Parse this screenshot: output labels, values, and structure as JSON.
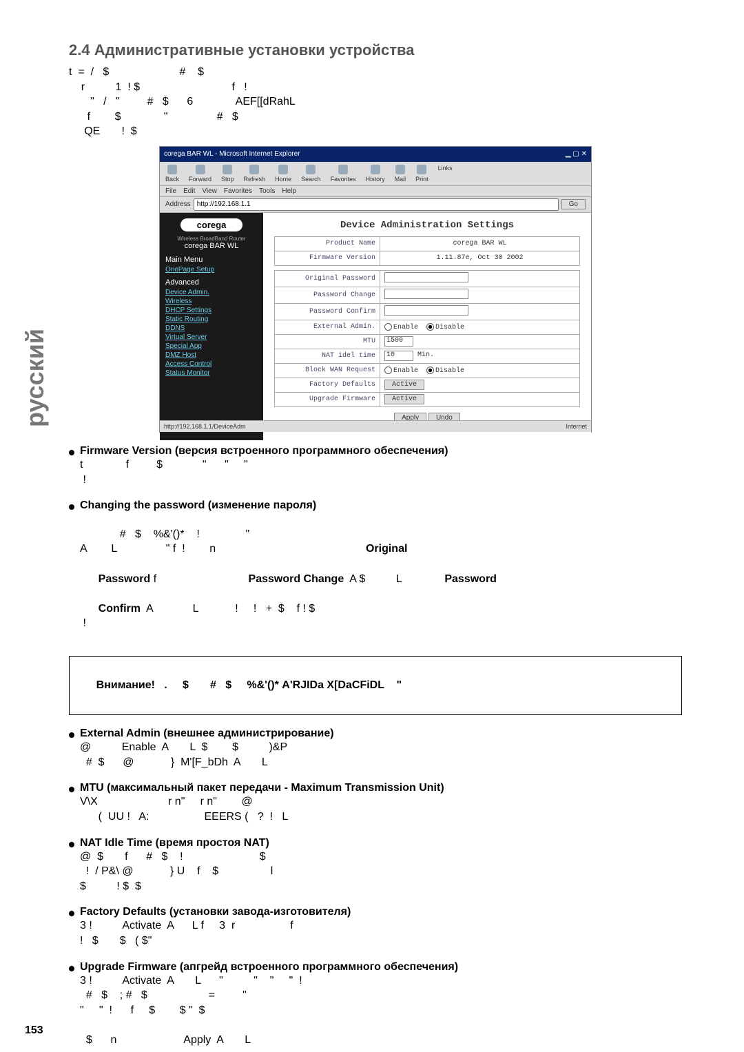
{
  "page_number": "153",
  "side_label": "русский",
  "heading": "2.4 Административные установки устройства",
  "intro_lines": "t  =  /   $                       #    $\n    r          1  ! $                              f   !\n       \"   /   \"         #   $      6              AEF[[dRahL\n      f        $              \"                #   $\n     QE       !  $",
  "browser": {
    "title": "corega BAR WL - Microsoft Internet Explorer",
    "toolbar": {
      "back": "Back",
      "forward": "Forward",
      "stop": "Stop",
      "refresh": "Refresh",
      "home": "Home",
      "search": "Search",
      "favorites": "Favorites",
      "history": "History",
      "mail": "Mail",
      "print": "Print",
      "links": "Links"
    },
    "menubar": [
      "File",
      "Edit",
      "View",
      "Favorites",
      "Tools",
      "Help"
    ],
    "address_label": "Address",
    "address_value": "http://192.168.1.1",
    "go": "Go",
    "status_left": "http://192.168.1.1/DeviceAdm",
    "status_right": "Internet"
  },
  "app": {
    "logo": "corega",
    "sub": "Wireless BroadBand Router",
    "name": "corega BAR WL",
    "main_menu": "Main Menu",
    "onepage": "OnePage Setup",
    "advanced": "Advanced",
    "links": [
      "Device Admin.",
      "Wireless",
      "DHCP Settings",
      "Static Routing",
      "DDNS",
      "Virtual Server",
      "Special App",
      "DMZ Host",
      "Access Control",
      "Status Monitor"
    ],
    "title": "Device Administration Settings",
    "rows": {
      "product_name": {
        "label": "Product Name",
        "value": "corega BAR WL"
      },
      "fw_version": {
        "label": "Firmware Version",
        "value": "1.11.87e, Oct 30 2002"
      },
      "orig_pw": {
        "label": "Original Password"
      },
      "pw_change": {
        "label": "Password Change"
      },
      "pw_confirm": {
        "label": "Password Confirm"
      },
      "ext_admin": {
        "label": "External Admin.",
        "enable": "Enable",
        "disable": "Disable"
      },
      "mtu": {
        "label": "MTU",
        "value": "1500"
      },
      "nat_idle": {
        "label": "NAT idel time",
        "value": "10",
        "unit": "Min."
      },
      "block_wan": {
        "label": "Block WAN Request",
        "enable": "Enable",
        "disable": "Disable"
      },
      "factory": {
        "label": "Factory Defaults",
        "btn": "Active"
      },
      "upgrade": {
        "label": "Upgrade Firmware",
        "btn": "Active"
      }
    },
    "apply": "Apply",
    "undo": "Undo"
  },
  "bullets": {
    "fw": {
      "title": "Firmware Version (версия встроенного программного обеспечения)",
      "body": "t              f         $             \"      \"     \"\n !"
    },
    "pw": {
      "title": "Changing the password (изменение пароля)",
      "body": "       #   $    %&'()*    !               \"\nA        L                \" f  !        n                                                 ",
      "original": "Original",
      "password_lbl": "Password",
      "pw_f": " f                              ",
      "pw_change": "Password Change",
      "pw_a": "  A $          L              ",
      "password_lbl2": "Password",
      "confirm": "Confirm",
      "conf_rest": "  A             L            !     !   +  $    f ! $\n !"
    },
    "ext": {
      "title": "External Admin (внешнее администрирование)",
      "body": "@          Enable  A       L  $        $          )&P\n  #  $      @            }  M'[F_bDh  A       L"
    },
    "mtu": {
      "title": "MTU  (максимальный пакет передачи - Maximum Transmission Unit)",
      "body": "V\\X                       r n\"     r n\"        @\n      (  UU !   A:                  EEERS (   ?  !   L"
    },
    "nat": {
      "title": "NAT Idle Time (время простоя NAT)",
      "body": "@  $       f      #   $    !                         $\n  !  / P&\\ @            } U    f    $                 l\n$          ! $  $"
    },
    "fact": {
      "title": "Factory Defaults (установки завода-изготовителя)",
      "body": "3 !          Activate  A      L f     3  r                  f\n!   $       $   ( $\""
    },
    "upg": {
      "title": "Upgrade Firmware (апгрейд встроенного программного обеспечения)",
      "body": "3 !          Activate  A       L      \"          \"    \"     \"  !\n  #   $    ; #   $                    =         \"\n\"     \"  !      f     $        $ \"  $\n\n  $      n                      Apply  A       L"
    }
  },
  "callout": "Внимание!   .     $       #   $     %&'()* A'RJIDa X[DaCFiDL    \""
}
